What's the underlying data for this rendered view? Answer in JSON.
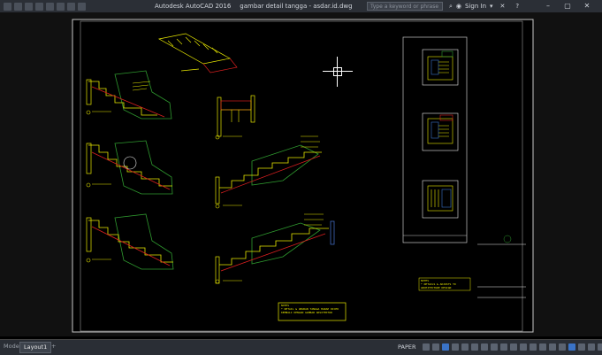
{
  "titlebar": {
    "app_title": "Autodesk AutoCAD 2016",
    "file_name": "gambar detail tangga - asdar.id.dwg",
    "search_placeholder": "Type a keyword or phrase",
    "sign_in": "Sign In"
  },
  "tabs": {
    "model": "Model",
    "layout1": "Layout1",
    "add": "+"
  },
  "statusbar": {
    "paper_label": "PAPER"
  },
  "drawing": {
    "notes_1": [
      "NOTES",
      "* DETAIL & UKURAN TANGGA HARAP DICEK",
      "KEMBALI DENGAN GAMBAR ARSITEKTUR"
    ],
    "notes_2": [
      "NOTES",
      "* DETAILS & ADJUSTS TO",
      "ARCHITECTURE DESIGN"
    ]
  },
  "colors": {
    "titlebar_bg": "#2b2f36",
    "canvas_bg": "#000000",
    "cad_green": "#2f9a2f",
    "cad_yellow": "#e8e800",
    "cad_red": "#d81f1f",
    "cad_white": "#e8e8e8",
    "accent_blue": "#3a73c7"
  }
}
